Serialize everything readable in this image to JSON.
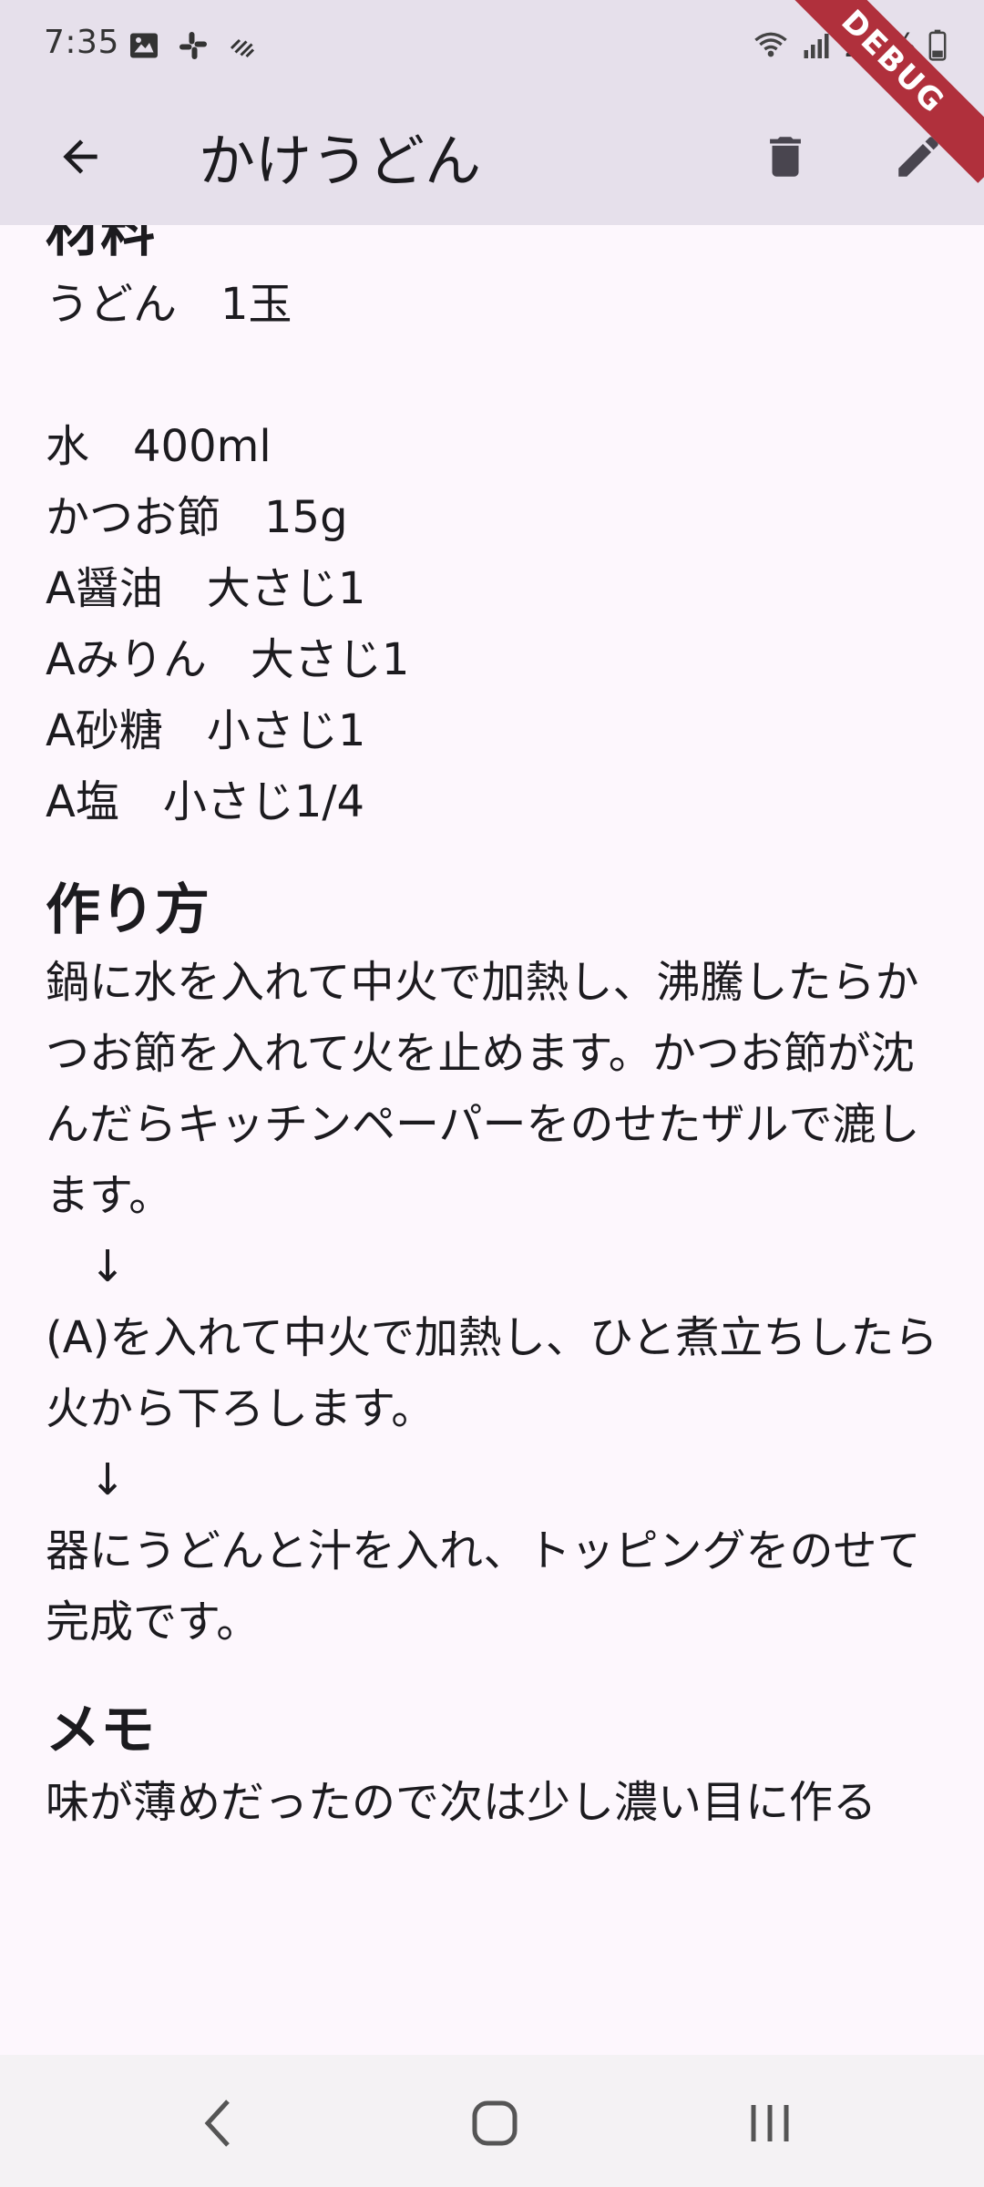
{
  "status_bar": {
    "time": "7:35",
    "battery": "22%",
    "icons": [
      "gallery-icon",
      "slack-icon",
      "signal-alt-icon",
      "wifi-icon",
      "cell-signal-icon",
      "battery-icon"
    ]
  },
  "app_bar": {
    "title": "かけうどん",
    "back_icon": "arrow-back-icon",
    "delete_icon": "trash-icon",
    "edit_icon": "pencil-icon"
  },
  "debug_banner": "DEBUG",
  "recipe": {
    "ingredients_heading": "材料",
    "ingredients_text": "うどん　1玉\n\n水　400ml\nかつお節　15g\nA醤油　大さじ1\nAみりん　大さじ1\nA砂糖　小さじ1\nA塩　小さじ1/4",
    "steps_heading": "作り方",
    "steps_text": "鍋に水を入れて中火で加熱し、沸騰したらかつお節を入れて火を止めます。かつお節が沈んだらキッチンペーパーをのせたザルで漉します。\n　↓\n(A)を入れて中火で加熱し、ひと煮立ちしたら火から下ろします。\n　↓\n器にうどんと汁を入れ、トッピングをのせて完成です。",
    "memo_heading": "メモ",
    "memo_text": "味が薄めだったので次は少し濃い目に作る"
  },
  "nav_bar": {
    "icons": [
      "nav-back-icon",
      "nav-home-icon",
      "nav-recents-icon"
    ]
  },
  "colors": {
    "app_bar_bg": "#e6e0eb",
    "page_bg": "#fdf7fd",
    "debug_ribbon": "#b0303c",
    "nav_bar_bg": "#f4f2f4"
  }
}
